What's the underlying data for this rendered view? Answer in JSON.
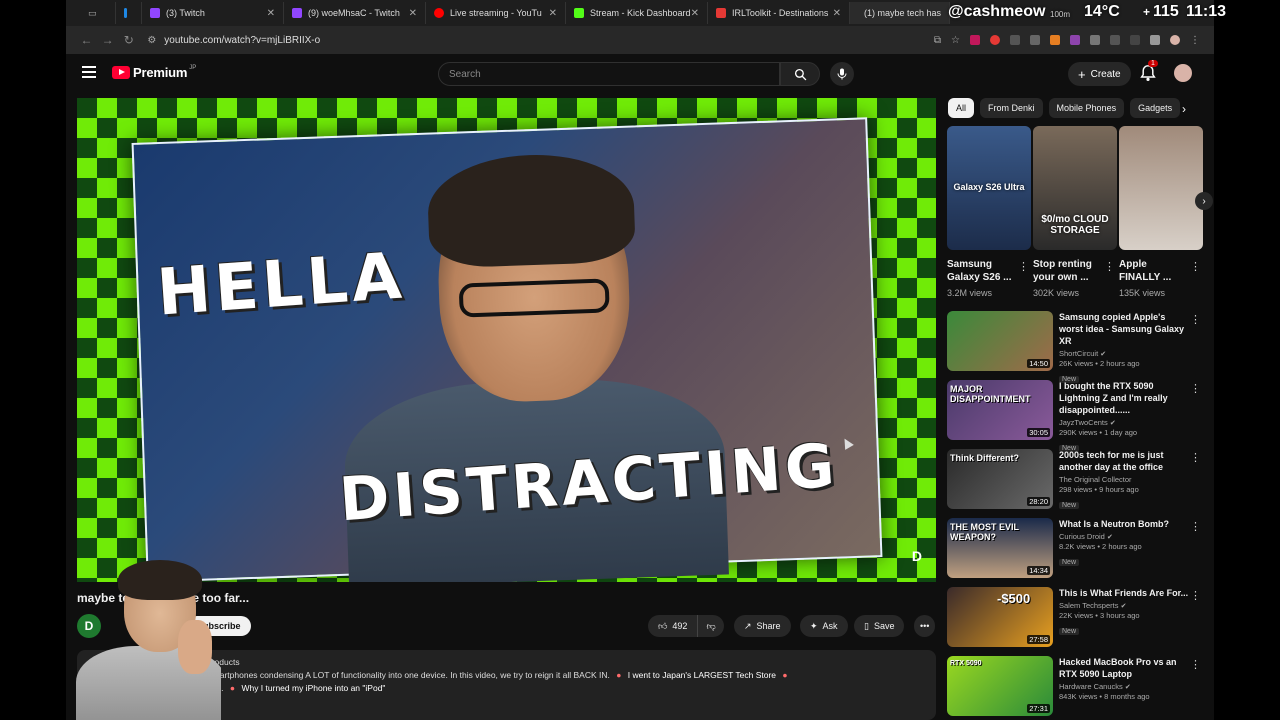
{
  "browser": {
    "tabs": [
      {
        "label": "(3) Twitch",
        "color": "#9146ff"
      },
      {
        "label": "(9) woeMhsaC - Twitch",
        "color": "#9146ff"
      },
      {
        "label": "Live streaming - YouTu",
        "color": "#ff0000"
      },
      {
        "label": "Stream - Kick Dashboard",
        "color": "#53fc18"
      },
      {
        "label": "IRLToolkit - Destinations",
        "color": "#e53935"
      },
      {
        "label": "(1) maybe tech has",
        "color": "#ff0000"
      }
    ],
    "url": "youtube.com/watch?v=mjLiBRIIX-o"
  },
  "overlay": {
    "handle": "@cashmeow",
    "temp": "14°C",
    "heart_rate": "115",
    "clock": "11:13",
    "small_note": "100m"
  },
  "youtube": {
    "logo": "Premium",
    "logo_country": "JP",
    "search_placeholder": "Search",
    "create_label": "Create",
    "notification_count": "1"
  },
  "video": {
    "thumb_text_1": "HELLA",
    "thumb_text_2": "DISTRACTING",
    "corner_logo": "D",
    "title": "maybe tech has gone too far...",
    "channel_initial": "D",
    "subscribe_label": "Subscribe",
    "likes": "492",
    "share_label": "Share",
    "ask_label": "Ask",
    "save_label": "Save",
    "desc_line1_prefix": "products",
    "desc_line2": "Smartphones condensing A LOT of functionality into one device. In this video, we try to reign it all BACK IN.",
    "desc_link1": "I went to Japan's LARGEST Tech Store",
    "desc_line3_prefix": "be...",
    "desc_link2": "Why I turned my iPhone into an \"iPod\""
  },
  "sidebar": {
    "chips": [
      "All",
      "From Denki",
      "Mobile Phones",
      "Gadgets"
    ],
    "shorts": [
      {
        "title": "Samsung Galaxy S26 ...",
        "views": "3.2M views",
        "caption": "Galaxy S26 Ultra"
      },
      {
        "title": "Stop renting your own ...",
        "views": "302K views",
        "caption": "$0/mo CLOUD STORAGE"
      },
      {
        "title": "Apple FINALLY ...",
        "views": "135K views",
        "caption": ""
      }
    ],
    "recs": [
      {
        "title": "Samsung copied Apple's worst idea - Samsung Galaxy XR",
        "channel": "ShortCircuit",
        "meta": "26K views • 2 hours ago",
        "badge": "New",
        "duration": "14:50",
        "thumb_caption": ""
      },
      {
        "title": "I bought the RTX 5090 Lightning Z and I'm really disappointed......",
        "channel": "JayzTwoCents",
        "meta": "290K views • 1 day ago",
        "badge": "New",
        "duration": "30:05",
        "thumb_caption": "MAJOR DISAPPOINTMENT"
      },
      {
        "title": "2000s tech for me is just another day at the office",
        "channel": "The Original Collector",
        "meta": "298 views • 9 hours ago",
        "badge": "New",
        "duration": "28:20",
        "thumb_caption": "Think Different?"
      },
      {
        "title": "What Is a Neutron Bomb?",
        "channel": "Curious Droid",
        "meta": "8.2K views • 2 hours ago",
        "badge": "New",
        "duration": "14:34",
        "thumb_caption": "THE MOST EVIL WEAPON?"
      },
      {
        "title": "This is What Friends Are For...",
        "channel": "Salem Techsperts",
        "meta": "22K views • 3 hours ago",
        "badge": "New",
        "duration": "27:58",
        "thumb_caption": "-$500"
      },
      {
        "title": "Hacked MacBook Pro vs an RTX 5090 Laptop",
        "channel": "Hardware Canucks",
        "meta": "843K views • 8 months ago",
        "badge": "",
        "duration": "27:31",
        "thumb_caption": "RTX 5090"
      }
    ]
  }
}
